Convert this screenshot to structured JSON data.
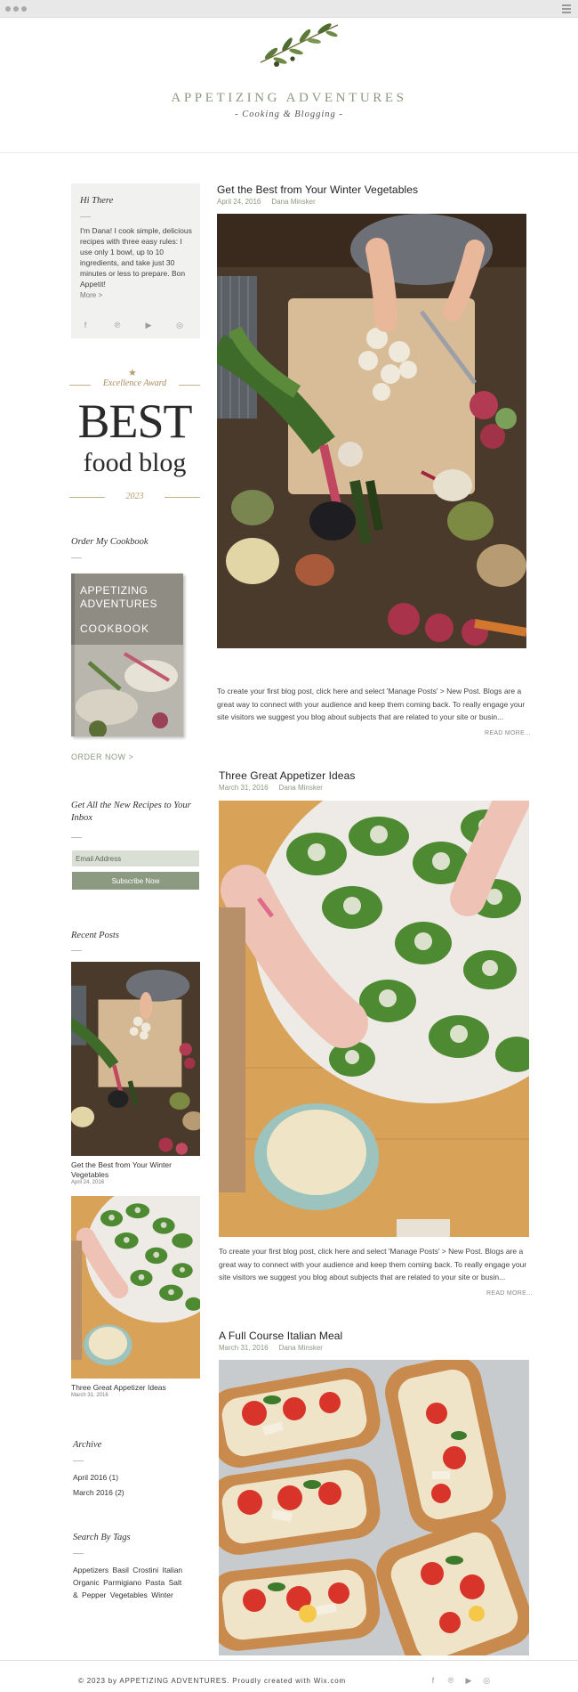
{
  "site": {
    "title": "APPETIZING ADVENTURES",
    "tagline": "- Cooking & Blogging -"
  },
  "about": {
    "title": "Hi There",
    "text": "I'm Dana! I cook simple, delicious recipes with three easy rules: I use only 1 bowl, up to 10 ingredients, and take just 30 minutes or less to prepare. Bon Appetit!",
    "more": "More >",
    "social_icons": [
      "facebook-icon",
      "pinterest-icon",
      "youtube-icon",
      "instagram-icon"
    ]
  },
  "award": {
    "label": "Excellence Award",
    "best": "BEST",
    "food_blog": "food blog",
    "year": "2023"
  },
  "cookbook": {
    "title": "Order My Cookbook",
    "cover_line1": "APPETIZING",
    "cover_line2": "ADVENTURES",
    "cover_line3": "COOKBOOK",
    "order_link": "ORDER NOW >"
  },
  "newsletter": {
    "title": "Get All the New Recipes to Your Inbox",
    "email_placeholder": "Email Address",
    "button": "Subscribe Now"
  },
  "recent": {
    "title": "Recent Posts",
    "items": [
      {
        "title": "Get the Best from Your Winter Vegetables",
        "date": "April 24, 2016"
      },
      {
        "title": "Three Great Appetizer Ideas",
        "date": "March 31, 2016"
      }
    ]
  },
  "archive": {
    "title": "Archive",
    "items": [
      "April 2016 (1)",
      "March 2016 (2)"
    ]
  },
  "tags": {
    "title": "Search By Tags",
    "items": "Appetizers  Basil  Crostini  Italian  Organic  Parmigiano  Pasta  Salt & Pepper  Vegetables  Winter"
  },
  "posts": [
    {
      "title": "Get the Best from Your Winter Vegetables",
      "date": "April 24, 2016",
      "author": "Dana Minsker",
      "excerpt": "To create your first blog post, click here and select 'Manage Posts' > New Post. Blogs are a great way to connect with your audience and keep them coming back. To really engage your site visitors we suggest you blog about subjects that are related to your site or busin...",
      "read_more": "READ MORE..."
    },
    {
      "title": "Three Great Appetizer Ideas",
      "date": "March 31, 2016",
      "author": "Dana Minsker",
      "excerpt": "To create your first blog post, click here and select 'Manage Posts' > New Post. Blogs are a great way to connect with your audience and keep them coming back. To really engage your site visitors we suggest you blog about subjects that are related to your site or busin...",
      "read_more": "READ MORE..."
    },
    {
      "title": "A Full Course Italian Meal",
      "date": "March 31, 2016",
      "author": "Dana Minsker"
    }
  ],
  "footer": {
    "text": "© 2023 by APPETIZING ADVENTURES. Proudly created with Wix.com"
  },
  "colors": {
    "accent": "#8c9a80",
    "gold": "#b69a6a",
    "sidebar_bg": "#f1f2ef"
  }
}
